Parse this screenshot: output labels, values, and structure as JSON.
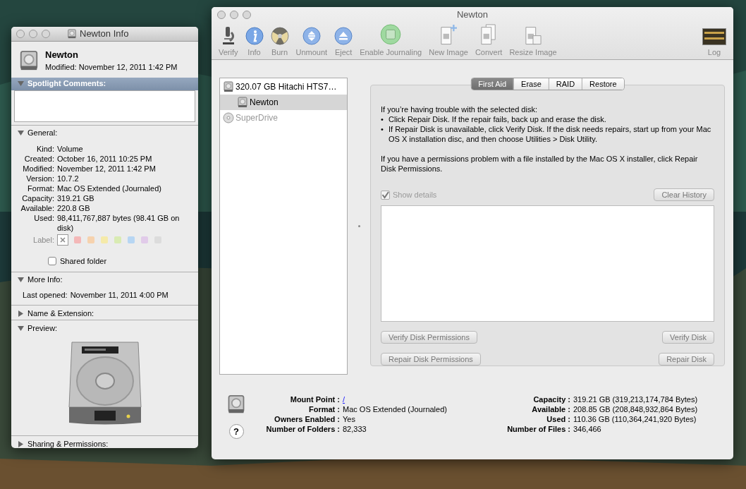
{
  "info_window": {
    "title": "Newton Info",
    "name": "Newton",
    "modified": "Modified: November 12, 2011 1:42 PM",
    "sections": [
      {
        "kind": "comments",
        "title": "Spotlight Comments:",
        "expanded": true
      },
      {
        "kind": "general",
        "title": "General:",
        "expanded": true,
        "rows": [
          {
            "label": "Kind:",
            "value": "Volume"
          },
          {
            "label": "Created:",
            "value": "October 16, 2011 10:25 PM"
          },
          {
            "label": "Modified:",
            "value": "November 12, 2011 1:42 PM"
          },
          {
            "label": "Version:",
            "value": "10.7.2"
          },
          {
            "label": "Format:",
            "value": "Mac OS Extended (Journaled)"
          },
          {
            "label": "Capacity:",
            "value": "319.21 GB"
          },
          {
            "label": "Available:",
            "value": "220.8 GB"
          },
          {
            "label": "Used:",
            "value": "98,411,767,887 bytes (98.41 GB on disk)"
          }
        ],
        "label_title": "Label:",
        "label_colors": [
          {
            "color": "#f4b8b8"
          },
          {
            "color": "#f6d2ae"
          },
          {
            "color": "#f5eaa9"
          },
          {
            "color": "#d9ebb3"
          },
          {
            "color": "#b7d6f3"
          },
          {
            "color": "#e1cbe9"
          },
          {
            "color": "#dcdcdc"
          }
        ],
        "shared_folder": {
          "label": "Shared folder",
          "checked": false
        }
      },
      {
        "kind": "more",
        "title": "More Info:",
        "expanded": true,
        "rows": [
          {
            "label": "Last opened:",
            "value": "November 11, 2011 4:00 PM"
          }
        ]
      },
      {
        "kind": "plain",
        "title": "Name & Extension:",
        "expanded": false
      },
      {
        "kind": "preview",
        "title": "Preview:",
        "expanded": true
      },
      {
        "kind": "plain",
        "title": "Sharing & Permissions:",
        "expanded": false
      }
    ]
  },
  "disk_utility": {
    "title": "Newton",
    "toolbar": [
      {
        "kind": "microscope",
        "label": "Verify"
      },
      {
        "kind": "info",
        "label": "Info"
      },
      {
        "kind": "burn",
        "label": "Burn"
      },
      {
        "kind": "unmount",
        "label": "Unmount"
      },
      {
        "kind": "eject",
        "label": "Eject"
      },
      {
        "kind": "journal",
        "label": "Enable Journaling"
      },
      {
        "kind": "newimage",
        "label": "New Image"
      },
      {
        "kind": "convert",
        "label": "Convert"
      },
      {
        "kind": "resize",
        "label": "Resize Image"
      },
      {
        "kind": "spacer"
      },
      {
        "kind": "log",
        "label": "Log"
      }
    ],
    "sidebar": [
      {
        "label": "320.07 GB Hitachi HTS7…",
        "kind": "disk",
        "selected": false,
        "disabled": false,
        "children": [
          {
            "label": "Newton",
            "kind": "disk",
            "selected": true,
            "disabled": false
          }
        ]
      },
      {
        "label": "SuperDrive",
        "kind": "optical",
        "selected": false,
        "disabled": true
      }
    ],
    "tabs": [
      {
        "label": "First Aid",
        "selected": true
      },
      {
        "label": "Erase",
        "selected": false
      },
      {
        "label": "RAID",
        "selected": false
      },
      {
        "label": "Restore",
        "selected": false
      }
    ],
    "intro": "If you’re having trouble with the selected disk:",
    "bullet_mark": "•",
    "bullets": [
      "Click Repair Disk. If the repair fails, back up and erase the disk.",
      "If Repair Disk is unavailable, click Verify Disk. If the disk needs repairs, start up from your Mac OS X installation disc, and then choose Utilities > Disk Utility."
    ],
    "permissions_note": "If you have a permissions problem with a file installed by the Mac OS X installer, click Repair Disk Permissions.",
    "show_details": {
      "label": "Show details",
      "checked": true,
      "disabled": true
    },
    "clear_history": "Clear History",
    "buttons": [
      [
        "Verify Disk Permissions",
        "Verify Disk"
      ],
      [
        "Repair Disk Permissions",
        "Repair Disk"
      ]
    ],
    "info_left": [
      {
        "label": "Mount Point :",
        "value": "/",
        "kind": "link"
      },
      {
        "label": "Format :",
        "value": "Mac OS Extended (Journaled)",
        "kind": "text"
      },
      {
        "label": "Owners Enabled :",
        "value": "Yes",
        "kind": "text"
      },
      {
        "label": "Number of Folders :",
        "value": "82,333",
        "kind": "text"
      }
    ],
    "info_right": [
      {
        "label": "Capacity :",
        "value": "319.21 GB (319,213,174,784 Bytes)",
        "kind": "text"
      },
      {
        "label": "Available :",
        "value": "208.85 GB (208,848,932,864 Bytes)",
        "kind": "text"
      },
      {
        "label": "Used :",
        "value": "110.36 GB (110,364,241,920 Bytes)",
        "kind": "text"
      },
      {
        "label": "Number of Files :",
        "value": "346,466",
        "kind": "text"
      }
    ],
    "help": "?"
  }
}
